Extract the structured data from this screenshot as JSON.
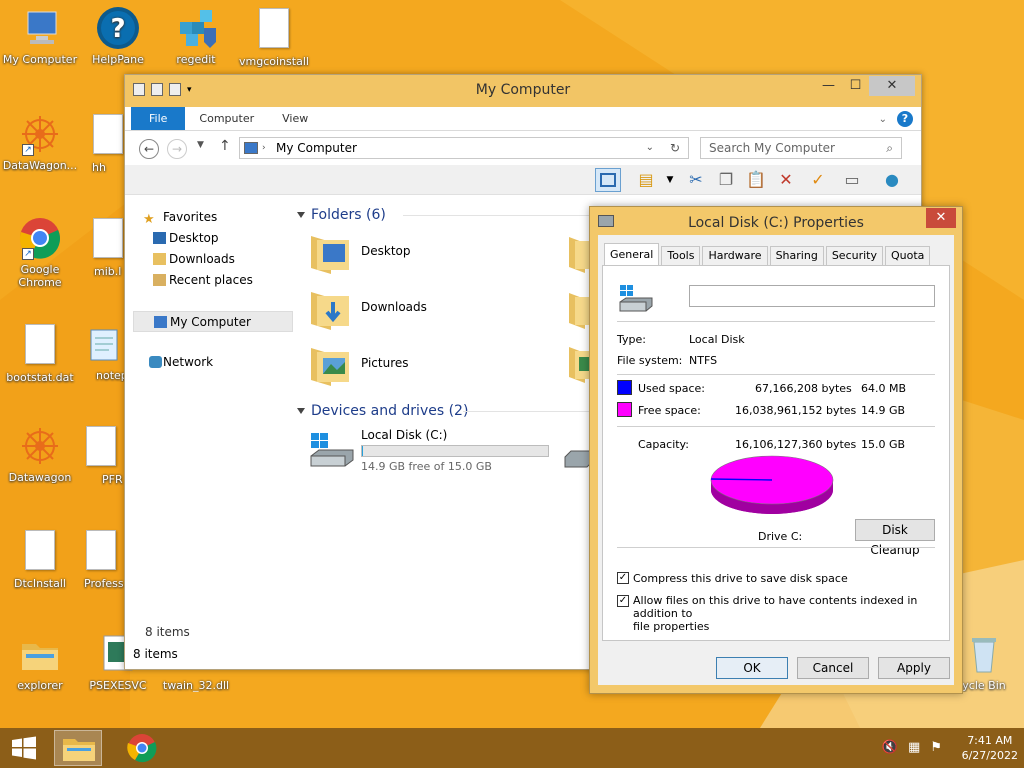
{
  "colors": {
    "desktop": "#f4a81f",
    "accent": "#1979ca",
    "used": "#0000ff",
    "free": "#ff00ff"
  },
  "desktop_icons": [
    {
      "label": "My Computer",
      "icon": "computer-icon"
    },
    {
      "label": "HelpPane",
      "icon": "help-icon"
    },
    {
      "label": "regedit",
      "icon": "registry-icon"
    },
    {
      "label": "vmgcoinstall",
      "icon": "file-icon"
    },
    {
      "label": "DataWagon...",
      "icon": "datawagon-icon"
    },
    {
      "label": "hh",
      "icon": "file-icon"
    },
    {
      "label": "Google Chrome",
      "icon": "chrome-icon"
    },
    {
      "label": "mib.l",
      "icon": "file-icon"
    },
    {
      "label": "bootstat.dat",
      "icon": "file-icon"
    },
    {
      "label": "notep",
      "icon": "notepad-icon"
    },
    {
      "label": "Datawagon",
      "icon": "datawagon-icon"
    },
    {
      "label": "PFR",
      "icon": "file-icon"
    },
    {
      "label": "DtcInstall",
      "icon": "file-icon"
    },
    {
      "label": "Profess",
      "icon": "file-icon"
    },
    {
      "label": "explorer",
      "icon": "folder-icon"
    },
    {
      "label": "PSEXESVC",
      "icon": "exe-icon"
    },
    {
      "label": "twain_32.dll",
      "icon": "dll-icon"
    },
    {
      "label": "ycle Bin",
      "icon": "recycle-bin-icon"
    }
  ],
  "explorer": {
    "title": "My Computer",
    "ribbon_tabs": [
      "File",
      "Computer",
      "View"
    ],
    "address": "My Computer",
    "search_placeholder": "Search My Computer",
    "nav": {
      "favorites": "Favorites",
      "items": [
        "Desktop",
        "Downloads",
        "Recent places"
      ],
      "my_computer": "My Computer",
      "network": "Network"
    },
    "folders_header": "Folders (6)",
    "folders": [
      "Desktop",
      "Downloads",
      "Pictures"
    ],
    "devices_header": "Devices and drives (2)",
    "drive": {
      "name": "Local Disk (C:)",
      "free_text": "14.9 GB free of 15.0 GB",
      "used_fraction": 0.004
    },
    "items_count": "8 items",
    "status_items": "8 items"
  },
  "props": {
    "title": "Local Disk (C:) Properties",
    "tabs": [
      "General",
      "Tools",
      "Hardware",
      "Sharing",
      "Security",
      "Quota"
    ],
    "name_value": "",
    "type_label": "Type:",
    "type_value": "Local Disk",
    "fs_label": "File system:",
    "fs_value": "NTFS",
    "used_label": "Used space:",
    "used_bytes": "67,166,208 bytes",
    "used_gb": "64.0 MB",
    "free_label": "Free space:",
    "free_bytes": "16,038,961,152 bytes",
    "free_gb": "14.9 GB",
    "cap_label": "Capacity:",
    "cap_bytes": "16,106,127,360 bytes",
    "cap_gb": "15.0 GB",
    "drive_label": "Drive C:",
    "cleanup": "Disk Cleanup",
    "compress": "Compress this drive to save disk space",
    "index_line1": "Allow files on this drive to have contents indexed in addition to",
    "index_line2": "file properties",
    "ok": "OK",
    "cancel": "Cancel",
    "apply": "Apply"
  },
  "tray": {
    "time": "7:41 AM",
    "date": "6/27/2022"
  }
}
